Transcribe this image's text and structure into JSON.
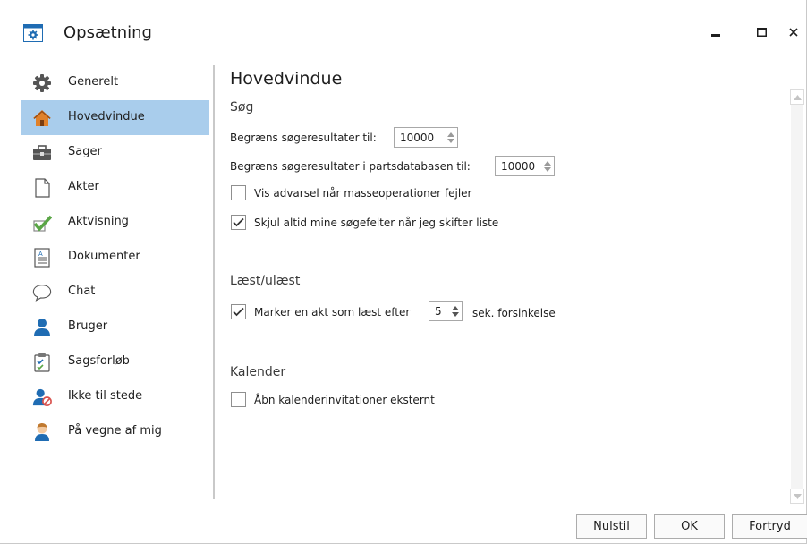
{
  "window": {
    "title": "Opsætning"
  },
  "sidebar": {
    "items": [
      {
        "label": "Generelt",
        "icon": "gear-icon",
        "selected": false
      },
      {
        "label": "Hovedvindue",
        "icon": "home-icon",
        "selected": true
      },
      {
        "label": "Sager",
        "icon": "briefcase-icon",
        "selected": false
      },
      {
        "label": "Akter",
        "icon": "blank-page-icon",
        "selected": false
      },
      {
        "label": "Aktvisning",
        "icon": "checkmark-icon",
        "selected": false
      },
      {
        "label": "Dokumenter",
        "icon": "document-icon",
        "selected": false
      },
      {
        "label": "Chat",
        "icon": "speech-bubble-icon",
        "selected": false
      },
      {
        "label": "Bruger",
        "icon": "user-icon",
        "selected": false
      },
      {
        "label": "Sagsforløb",
        "icon": "clipboard-check-icon",
        "selected": false
      },
      {
        "label": "Ikke til stede",
        "icon": "user-unavailable-icon",
        "selected": false
      },
      {
        "label": "På vegne af mig",
        "icon": "user-avatar-icon",
        "selected": false
      }
    ]
  },
  "main": {
    "title": "Hovedvindue",
    "search": {
      "heading": "Søg",
      "limit_label": "Begræns søgeresultater til:",
      "limit_value": "10000",
      "party_limit_label": "Begræns søgeresultater i partsdatabasen til:",
      "party_limit_value": "10000",
      "warn_label": "Vis advarsel når masseoperationer fejler",
      "warn_checked": false,
      "hide_label": "Skjul altid mine søgefelter når jeg skifter liste",
      "hide_checked": true
    },
    "read": {
      "heading": "Læst/ulæst",
      "mark_label": "Marker en akt som læst efter",
      "mark_value": "5",
      "delay_suffix": "sek. forsinkelse",
      "mark_checked": true
    },
    "calendar": {
      "heading": "Kalender",
      "open_label": "Åbn kalenderinvitationer eksternt",
      "open_checked": false
    }
  },
  "footer": {
    "reset_label": "Nulstil",
    "ok_label": "OK",
    "cancel_label": "Fortryd"
  },
  "colors": {
    "selected_bg": "#a9cdec",
    "accent_green": "#5aa646",
    "user_blue": "#1f6cb3"
  }
}
